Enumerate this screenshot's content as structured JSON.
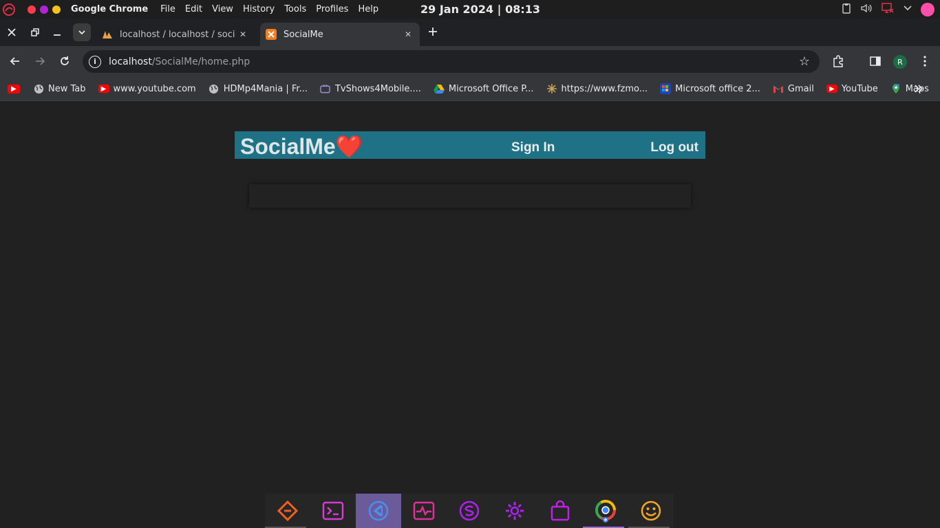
{
  "system_bar": {
    "app_name": "Google Chrome",
    "menu": [
      "File",
      "Edit",
      "View",
      "History",
      "Tools",
      "Profiles",
      "Help"
    ],
    "clock": "29 Jan 2024 | 08:13",
    "dot_colors": [
      "#ff3b4e",
      "#b024d6",
      "#f2c21b"
    ]
  },
  "tabs": [
    {
      "title": "localhost / localhost / socia",
      "favicon": "phpmyadmin-icon",
      "active": false
    },
    {
      "title": "SocialMe",
      "favicon": "xampp-icon",
      "active": true
    }
  ],
  "omnibox": {
    "host": "localhost",
    "path": "/SocialMe/home.php"
  },
  "profile_initial": "R",
  "bookmarks": [
    {
      "label": "",
      "icon": "youtube-icon"
    },
    {
      "label": "New Tab",
      "icon": "globe-icon"
    },
    {
      "label": "www.youtube.com",
      "icon": "youtube-icon"
    },
    {
      "label": "HDMp4Mania | Fr...",
      "icon": "globe-icon"
    },
    {
      "label": "TvShows4Mobile....",
      "icon": "tv-icon"
    },
    {
      "label": "Microsoft Office P...",
      "icon": "drive-icon"
    },
    {
      "label": "https://www.fzmo...",
      "icon": "star-burst-icon"
    },
    {
      "label": "Microsoft office 2...",
      "icon": "office-icon"
    },
    {
      "label": "Gmail",
      "icon": "gmail-icon"
    },
    {
      "label": "YouTube",
      "icon": "youtube-icon"
    },
    {
      "label": "Maps",
      "icon": "maps-icon"
    }
  ],
  "site": {
    "logo": "SocialMe",
    "heart": "❤️",
    "sign_in": "Sign In",
    "log_out": "Log out",
    "nav_color": "#1f7285"
  },
  "dock": [
    {
      "name": "git-app-icon",
      "color": "#f06020"
    },
    {
      "name": "terminal-icon",
      "color": "#d63ad6"
    },
    {
      "name": "vscode-icon",
      "color": "#4a8ff0"
    },
    {
      "name": "activity-monitor-icon",
      "color": "#e0309a"
    },
    {
      "name": "sublime-icon",
      "color": "#b020f0"
    },
    {
      "name": "settings-gear-icon",
      "color": "#b020f0"
    },
    {
      "name": "store-bag-icon",
      "color": "#c020e8"
    },
    {
      "name": "chrome-icon",
      "color": "#4285f4"
    },
    {
      "name": "smiley-icon",
      "color": "#f5a623"
    }
  ]
}
